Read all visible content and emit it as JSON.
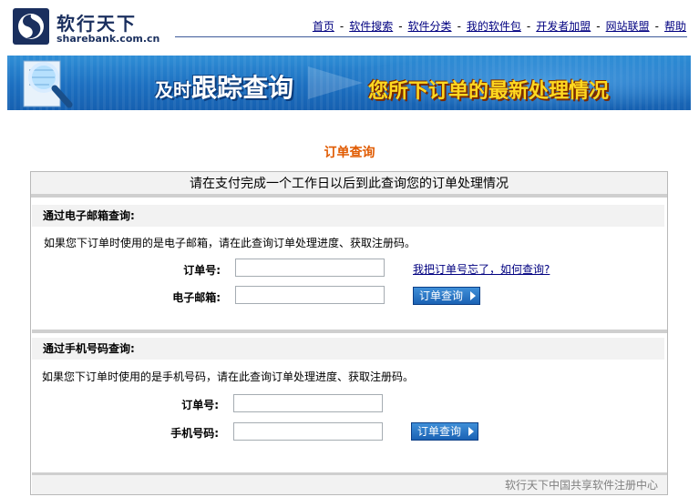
{
  "header": {
    "logo": {
      "name_cn": "软行天下",
      "domain": "sharebank.com.cn"
    },
    "nav": [
      {
        "label": "首页"
      },
      {
        "label": "软件搜索"
      },
      {
        "label": "软件分类"
      },
      {
        "label": "我的软件包"
      },
      {
        "label": "开发者加盟"
      },
      {
        "label": "网站联盟"
      },
      {
        "label": "帮助"
      }
    ],
    "nav_separator": "-"
  },
  "banner": {
    "title_small": "及时",
    "title_big": "跟踪查询",
    "subtitle": "您所下订单的最新处理情况"
  },
  "page_title": "订单查询",
  "box": {
    "header": "请在支付完成一个工作日以后到此查询您的订单处理情况",
    "email_section": {
      "heading": "通过电子邮箱查询:",
      "description": "如果您下订单时使用的是电子邮箱，请在此查询订单处理进度、获取注册码。",
      "order_label": "订单号:",
      "order_value": "",
      "email_label": "电子邮箱:",
      "email_value": "",
      "forgot_link": "我把订单号忘了，如何查询?",
      "submit_label": "订单查询"
    },
    "phone_section": {
      "heading": "通过手机号码查询:",
      "description": "如果您下订单时使用的是手机号码，请在此查询订单处理进度、获取注册码。",
      "order_label": "订单号:",
      "order_value": "",
      "phone_label": "手机号码:",
      "phone_value": "",
      "submit_label": "订单查询"
    },
    "footer": "软行天下中国共享软件注册中心"
  },
  "colors": {
    "nav_link": "#000080",
    "page_title": "#e05a00",
    "banner_blue": "#1c6fc0",
    "banner_sub": "#ffd820",
    "button": "#1b62b4"
  }
}
